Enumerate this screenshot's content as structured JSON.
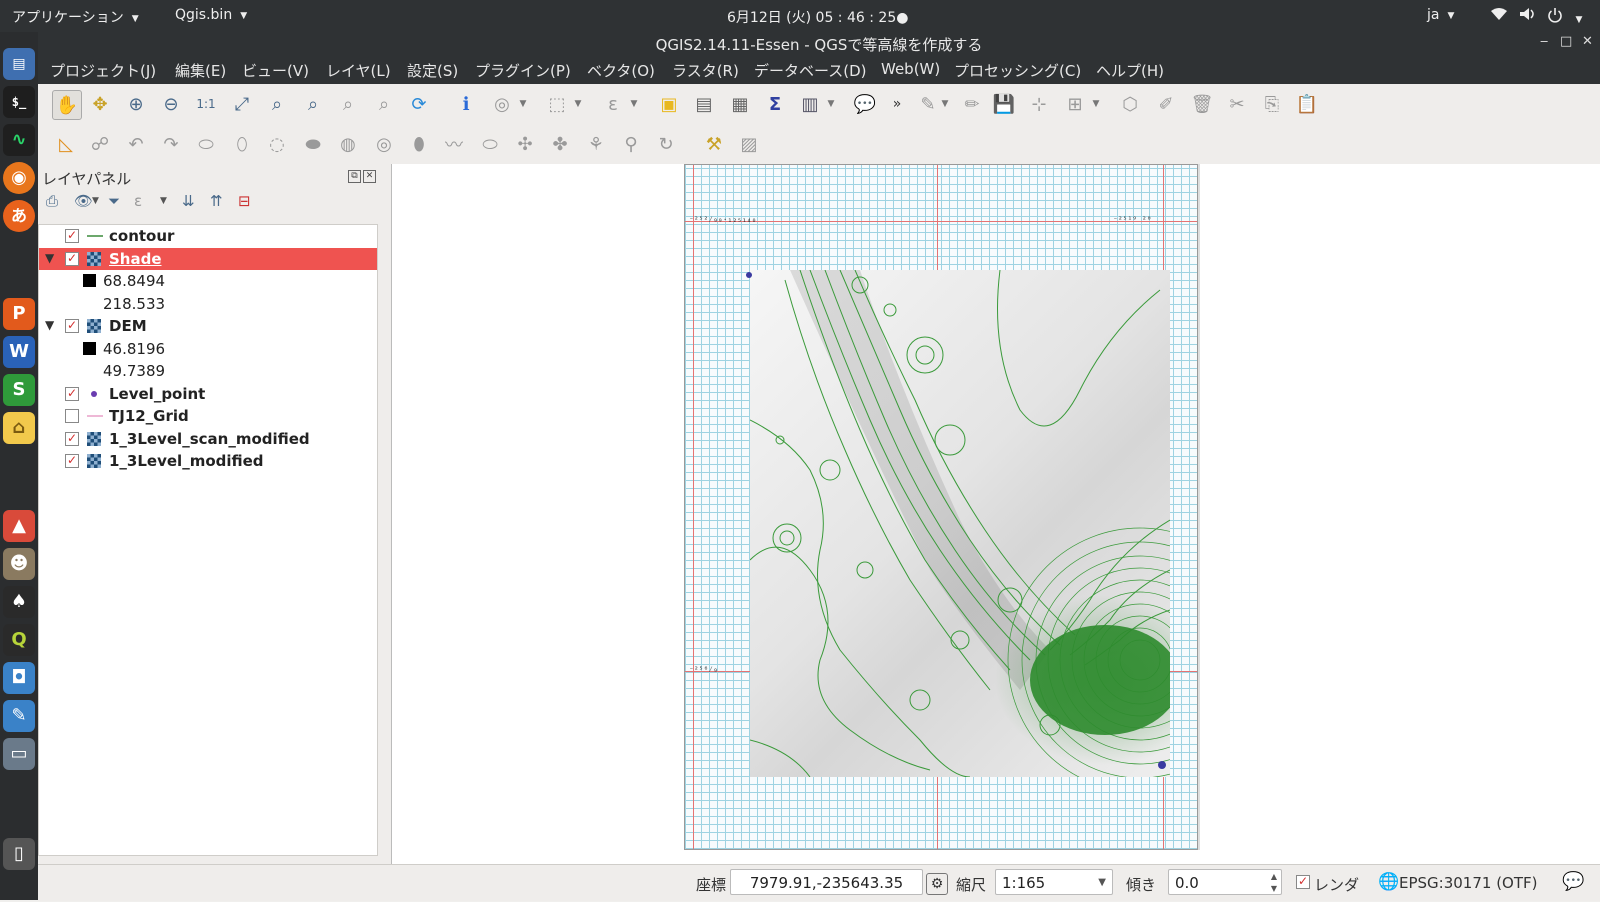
{
  "top_panel": {
    "applications_label": "アプリケーション",
    "app_label": "Qgis.bin",
    "clock": "6月12日 (火) 05 : 46 : 25●",
    "lang": "ja"
  },
  "window": {
    "title": "QGIS2.14.11-Essen - QGSで等高線を作成する",
    "minimize": "‒",
    "restore": "□",
    "close": "✕"
  },
  "menu": [
    "プロジェクト(J)",
    "編集(E)",
    "ビュー(V)",
    "レイヤ(L)",
    "設定(S)",
    "プラグイン(P)",
    "ベクタ(O)",
    "ラスタ(R)",
    "データベース(D)",
    "Web(W)",
    "プロセッシング(C)",
    "ヘルプ(H)"
  ],
  "layer_panel": {
    "title": "レイヤパネル",
    "layers": [
      {
        "name": "contour",
        "checked": true,
        "expanded": null,
        "icon": "line-icon",
        "color": "#3a8a3a"
      },
      {
        "name": "Shade",
        "checked": true,
        "expanded": true,
        "icon": "raster-icon",
        "selected": true,
        "min": "68.8494",
        "max": "218.533"
      },
      {
        "name": "DEM",
        "checked": true,
        "expanded": true,
        "icon": "raster-icon",
        "min": "46.8196",
        "max": "49.7389"
      },
      {
        "name": "Level_point",
        "checked": true,
        "expanded": null,
        "icon": "point-icon",
        "color": "#6a3db0"
      },
      {
        "name": "TJ12_Grid",
        "checked": false,
        "expanded": null,
        "icon": "line-icon",
        "color": "#e8a0c8"
      },
      {
        "name": "1_3Level_scan_modified",
        "checked": true,
        "expanded": null,
        "icon": "raster-icon"
      },
      {
        "name": "1_3Level_modified",
        "checked": true,
        "expanded": null,
        "icon": "raster-icon"
      }
    ]
  },
  "statusbar": {
    "coord_label": "座標",
    "coord_value": "7979.91,-235643.35",
    "scale_label": "縮尺",
    "scale_value": "1:165",
    "rotation_label": "傾き",
    "rotation_value": "0.0",
    "render_label": "レンダ",
    "crs": "EPSG:30171 (OTF)"
  },
  "colors": {
    "selection": "#ef5350",
    "contour_green": "#3a9a3a",
    "panel_dark": "#2f3234"
  }
}
